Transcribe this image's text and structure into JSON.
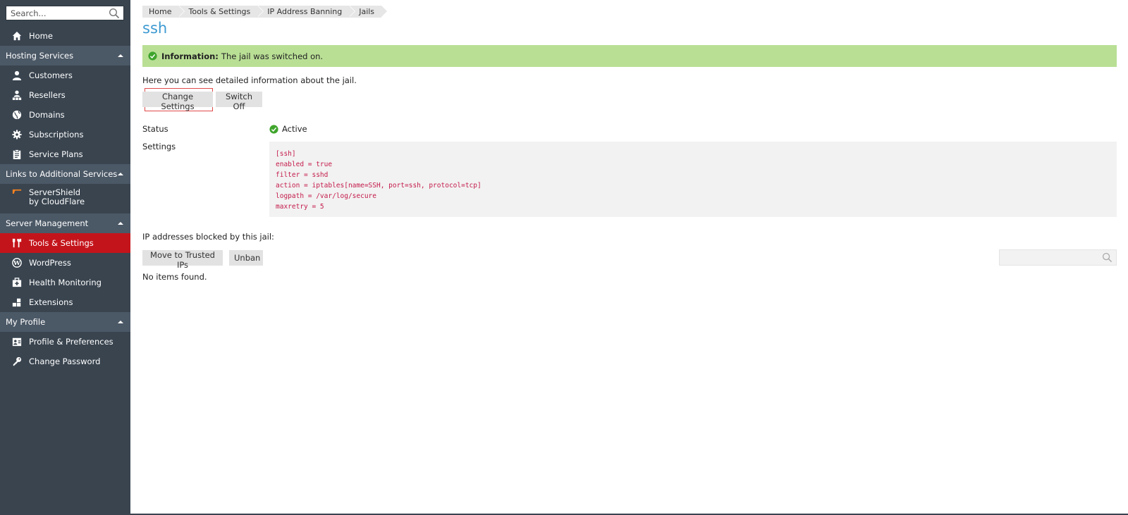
{
  "search": {
    "placeholder": "Search..."
  },
  "sidebar": {
    "home": "Home",
    "groups": [
      {
        "title": "Hosting Services",
        "items": [
          "Customers",
          "Resellers",
          "Domains",
          "Subscriptions",
          "Service Plans"
        ]
      },
      {
        "title": "Links to Additional Services",
        "items": [
          "ServerShield by CloudFlare"
        ]
      },
      {
        "title": "Server Management",
        "items": [
          "Tools & Settings",
          "WordPress",
          "Health Monitoring",
          "Extensions"
        ]
      },
      {
        "title": "My Profile",
        "items": [
          "Profile & Preferences",
          "Change Password"
        ]
      }
    ],
    "active_item": "Tools & Settings"
  },
  "breadcrumb": [
    "Home",
    "Tools & Settings",
    "IP Address Banning",
    "Jails"
  ],
  "page_title": "ssh",
  "info": {
    "label": "Information:",
    "text": "The jail was switched on."
  },
  "description": "Here you can see detailed information about the jail.",
  "buttons": {
    "change_settings": "Change Settings",
    "switch_off": "Switch Off",
    "move_trusted": "Move to Trusted IPs",
    "unban": "Unban"
  },
  "details": {
    "status_label": "Status",
    "status_value": "Active",
    "settings_label": "Settings",
    "settings_code": "[ssh]\nenabled = true\nfilter = sshd\naction = iptables[name=SSH, port=ssh, protocol=tcp]\nlogpath = /var/log/secure\nmaxretry = 5"
  },
  "blocked": {
    "label": "IP addresses blocked by this jail:",
    "empty": "No items found."
  },
  "colors": {
    "sidebar_bg": "#39444f",
    "group_bg": "#4b5866",
    "active": "#c4141b",
    "title": "#3d9ad1",
    "info_bg": "#b9df95",
    "code_text": "#c41a4a"
  }
}
